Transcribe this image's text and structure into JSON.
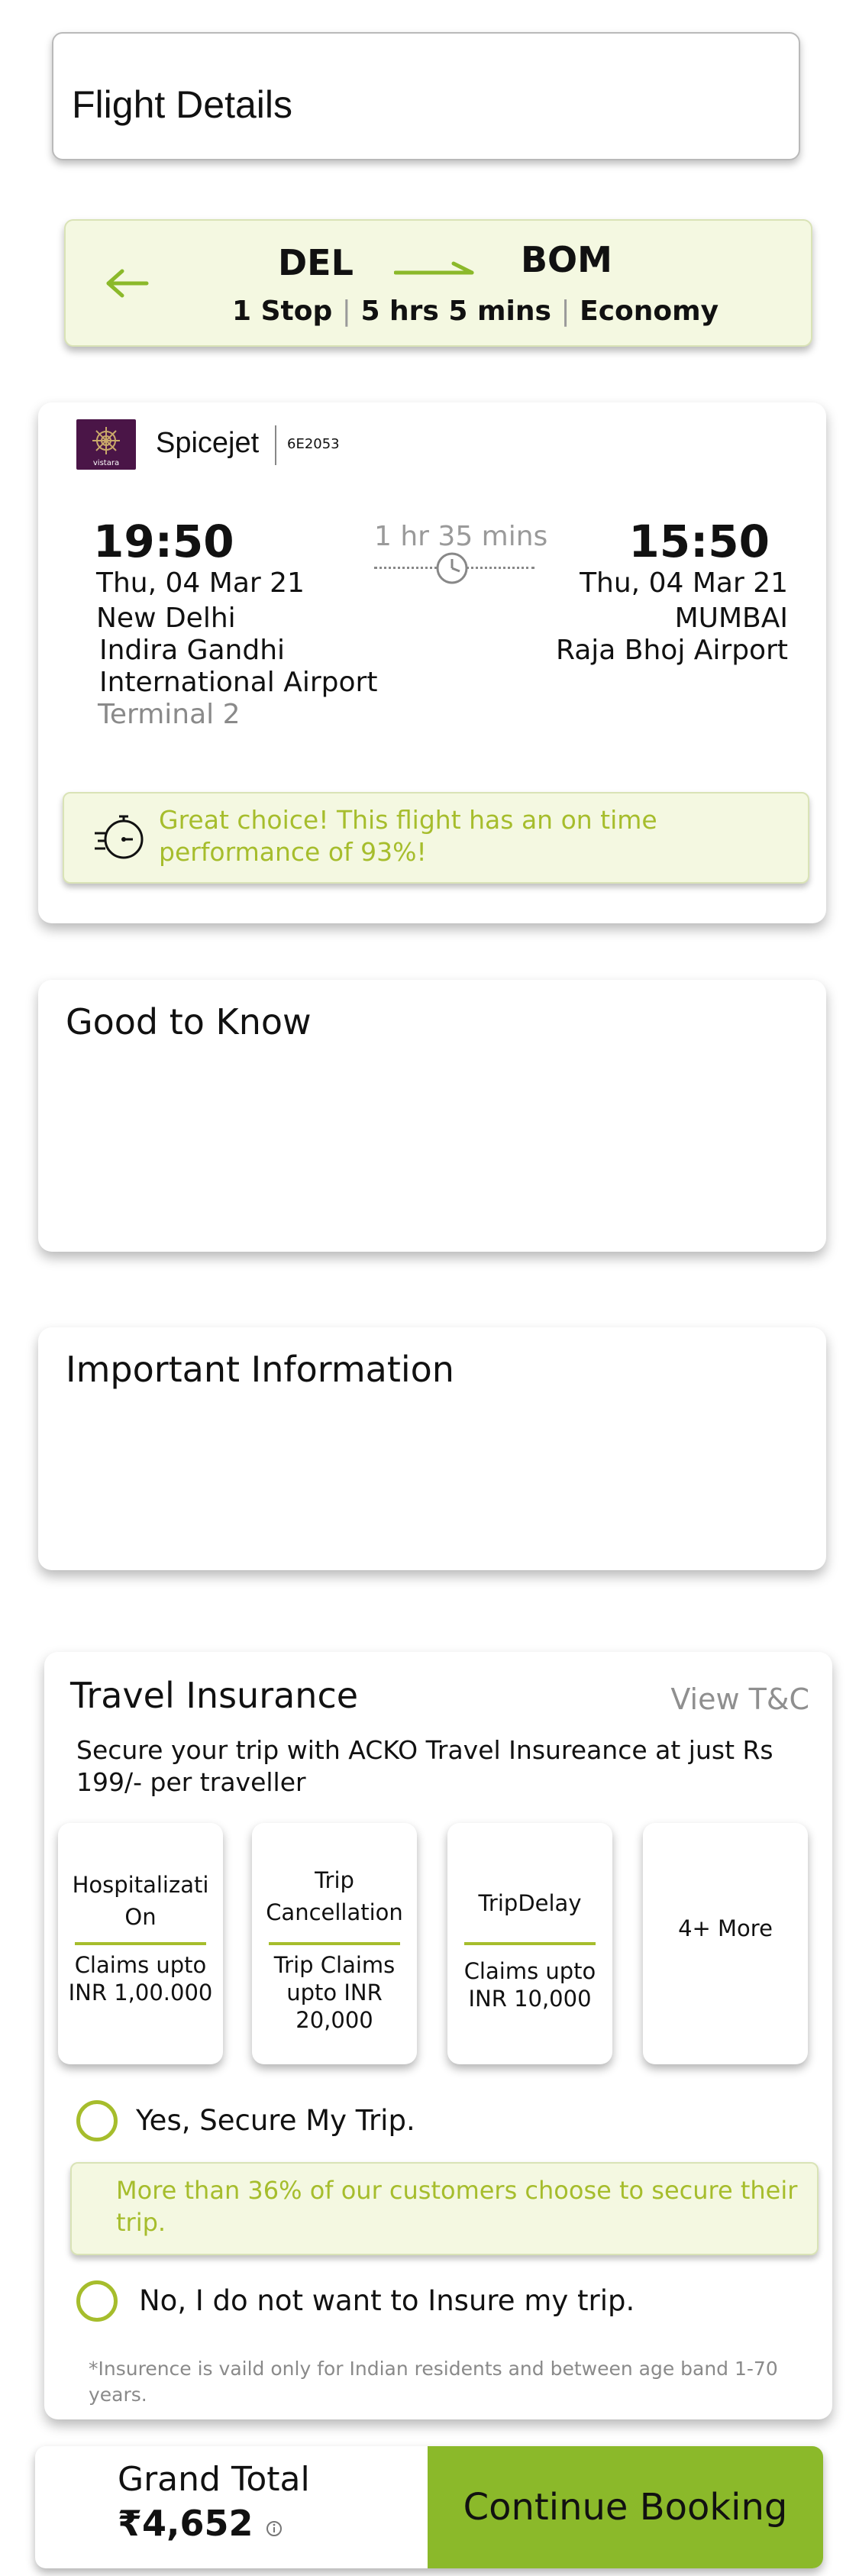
{
  "header": {
    "title": "Flight Details"
  },
  "route": {
    "origin": "DEL",
    "destination": "BOM",
    "stops": "1 Stop",
    "duration": "5 hrs 5 mins",
    "cabin": "Economy",
    "separator": "|",
    "back_icon": "arrow-left-icon",
    "direction_icon": "arrow-right-icon"
  },
  "flight": {
    "airline_name": "Spicejet",
    "flight_number": "6E2053",
    "logo_text": "vistara",
    "departure": {
      "time": "19:50",
      "date": "Thu, 04 Mar 21",
      "city": "New Delhi",
      "airport_line1": "Indira Gandhi",
      "airport_line2": "International Airport",
      "terminal": "Terminal 2"
    },
    "arrival": {
      "time": "15:50",
      "date": "Thu, 04 Mar 21",
      "city": "MUMBAI",
      "airport": "Raja Bhoj Airport"
    },
    "leg_duration": "1 hr 35 mins",
    "ontime_message": "Great choice! This flight has an on time performance of 93%!"
  },
  "good_to_know": {
    "title": "Good to Know"
  },
  "important_info": {
    "title": "Important Information"
  },
  "insurance": {
    "title": "Travel Insurance",
    "terms_link": "View T&C",
    "description": "Secure your trip with ACKO Travel Insureance at just Rs 199/- per traveller",
    "benefits": [
      {
        "title": "Hospitalizati On",
        "detail": "Claims upto INR 1,00.000"
      },
      {
        "title": "Trip Cancellation",
        "detail": "Trip Claims upto INR 20,000"
      },
      {
        "title": "TripDelay",
        "detail": "Claims upto INR 10,000"
      },
      {
        "title": "4+ More"
      }
    ],
    "option_yes": "Yes, Secure My Trip.",
    "promo": "More than 36% of our customers choose to secure their trip.",
    "option_no": "No, I do not want to Insure my trip.",
    "note": "*Insurence is vaild only for Indian residents and between age band 1-70 years.",
    "accent_color": "#a6bd2c"
  },
  "footer": {
    "grand_total_label": "Grand Total",
    "currency_symbol": "₹",
    "grand_total_value": "4,652",
    "info_icon": "info-icon",
    "continue_label": "Continue Booking",
    "button_color": "#8bb92a"
  }
}
